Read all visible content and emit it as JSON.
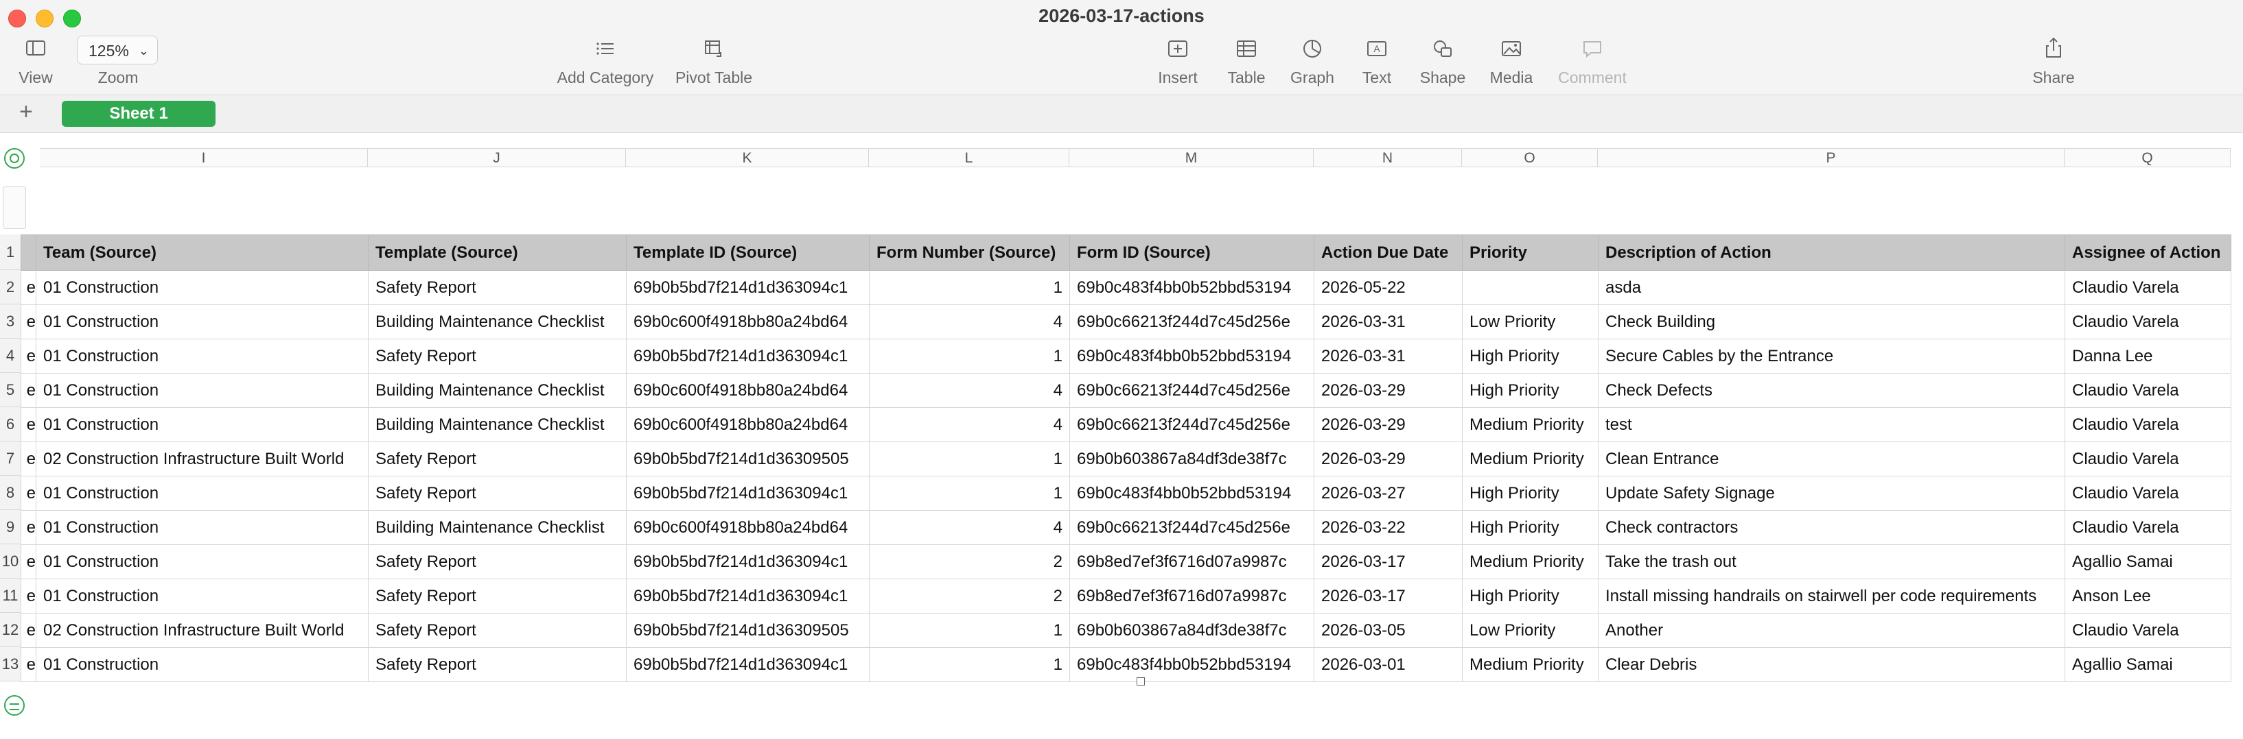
{
  "window": {
    "title": "2026-03-17-actions"
  },
  "toolbar": {
    "view": "View",
    "zoom_label": "Zoom",
    "zoom_value": "125%",
    "add_category": "Add Category",
    "pivot_table": "Pivot Table",
    "insert": "Insert",
    "table": "Table",
    "graph": "Graph",
    "text": "Text",
    "shape": "Shape",
    "media": "Media",
    "comment": "Comment",
    "share": "Share"
  },
  "sheets": {
    "add": "+",
    "active": "Sheet 1"
  },
  "columns": [
    "I",
    "J",
    "K",
    "L",
    "M",
    "N",
    "O",
    "P",
    "Q"
  ],
  "headers": [
    "Team (Source)",
    "Template (Source)",
    "Template ID (Source)",
    "Form Number (Source)",
    "Form ID (Source)",
    "Action Due Date",
    "Priority",
    "Description of Action",
    "Assignee of Action"
  ],
  "row_numbers": [
    "1",
    "2",
    "3",
    "4",
    "5",
    "6",
    "7",
    "8",
    "9",
    "10",
    "11",
    "12",
    "13"
  ],
  "rows": [
    [
      "01 Construction",
      "Safety Report",
      "69b0b5bd7f214d1d363094c1",
      "1",
      "69b0c483f4bb0b52bbd53194",
      "2026-05-22",
      "",
      "asda",
      "Claudio Varela"
    ],
    [
      "01 Construction",
      "Building Maintenance Checklist",
      "69b0c600f4918bb80a24bd64",
      "4",
      "69b0c66213f244d7c45d256e",
      "2026-03-31",
      "Low Priority",
      "Check Building",
      "Claudio Varela"
    ],
    [
      "01 Construction",
      "Safety Report",
      "69b0b5bd7f214d1d363094c1",
      "1",
      "69b0c483f4bb0b52bbd53194",
      "2026-03-31",
      "High Priority",
      "Secure Cables by the Entrance",
      "Danna Lee"
    ],
    [
      "01 Construction",
      "Building Maintenance Checklist",
      "69b0c600f4918bb80a24bd64",
      "4",
      "69b0c66213f244d7c45d256e",
      "2026-03-29",
      "High Priority",
      "Check Defects",
      "Claudio Varela"
    ],
    [
      "01 Construction",
      "Building Maintenance Checklist",
      "69b0c600f4918bb80a24bd64",
      "4",
      "69b0c66213f244d7c45d256e",
      "2026-03-29",
      "Medium Priority",
      "test",
      "Claudio Varela"
    ],
    [
      "02 Construction Infrastructure Built World",
      "Safety Report",
      "69b0b5bd7f214d1d36309505",
      "1",
      "69b0b603867a84df3de38f7c",
      "2026-03-29",
      "Medium Priority",
      "Clean Entrance",
      "Claudio Varela"
    ],
    [
      "01 Construction",
      "Safety Report",
      "69b0b5bd7f214d1d363094c1",
      "1",
      "69b0c483f4bb0b52bbd53194",
      "2026-03-27",
      "High Priority",
      "Update Safety Signage",
      "Claudio Varela"
    ],
    [
      "01 Construction",
      "Building Maintenance Checklist",
      "69b0c600f4918bb80a24bd64",
      "4",
      "69b0c66213f244d7c45d256e",
      "2026-03-22",
      "High Priority",
      "Check contractors",
      "Claudio Varela"
    ],
    [
      "01 Construction",
      "Safety Report",
      "69b0b5bd7f214d1d363094c1",
      "2",
      "69b8ed7ef3f6716d07a9987c",
      "2026-03-17",
      "Medium Priority",
      "Take the trash out",
      "Agallio Samai"
    ],
    [
      "01 Construction",
      "Safety Report",
      "69b0b5bd7f214d1d363094c1",
      "2",
      "69b8ed7ef3f6716d07a9987c",
      "2026-03-17",
      "High Priority",
      "Install missing handrails on stairwell per code requirements",
      "Anson Lee"
    ],
    [
      "02 Construction Infrastructure Built World",
      "Safety Report",
      "69b0b5bd7f214d1d36309505",
      "1",
      "69b0b603867a84df3de38f7c",
      "2026-03-05",
      "Low Priority",
      "Another",
      "Claudio Varela"
    ],
    [
      "01 Construction",
      "Safety Report",
      "69b0b5bd7f214d1d363094c1",
      "1",
      "69b0c483f4bb0b52bbd53194",
      "2026-03-01",
      "Medium Priority",
      "Clear Debris",
      "Agallio Samai"
    ]
  ],
  "partial_col_char": "e"
}
